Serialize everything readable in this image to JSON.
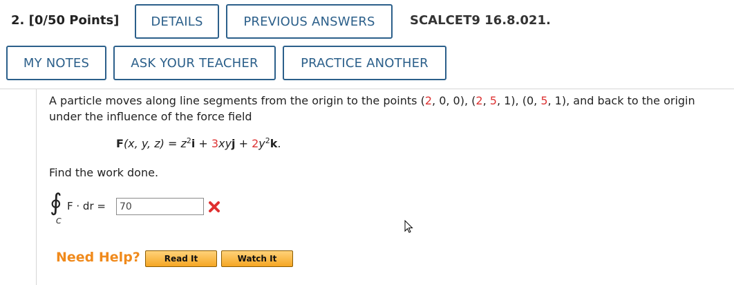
{
  "header": {
    "question_number": "2.",
    "points": "[0/50 Points]",
    "details_label": "DETAILS",
    "previous_answers_label": "PREVIOUS ANSWERS",
    "source_ref": "SCALCET9 16.8.021."
  },
  "toolbar": {
    "my_notes_label": "MY NOTES",
    "ask_teacher_label": "ASK YOUR TEACHER",
    "practice_another_label": "PRACTICE ANOTHER"
  },
  "problem": {
    "intro": "A particle moves along line segments from the origin to the points",
    "points": [
      {
        "a": "2",
        "b": "0",
        "c": "0"
      },
      {
        "a": "2",
        "b": "5",
        "c": "1"
      },
      {
        "a": "0",
        "b": "5",
        "c": "1"
      }
    ],
    "outro": "and back to the origin under the influence of the force field",
    "field": {
      "lhs_func": "F",
      "lhs_args": "(x, y, z) = ",
      "term1": "z",
      "term1_exp": "2",
      "term1_unit": "i",
      "coef2": "3",
      "term2": "xy",
      "term2_unit": "j",
      "coef3": "2",
      "term3": "y",
      "term3_exp": "2",
      "term3_unit": "k"
    },
    "prompt": "Find the work done."
  },
  "answer": {
    "integral_subscript": "C",
    "lhs": "F · dr =",
    "value": "70",
    "status": "incorrect"
  },
  "help": {
    "label": "Need Help?",
    "read_it_label": "Read It",
    "watch_it_label": "Watch It"
  },
  "colors": {
    "accent": "#2b5f8a",
    "highlight": "#dd3333",
    "help_orange": "#f08a1c"
  }
}
